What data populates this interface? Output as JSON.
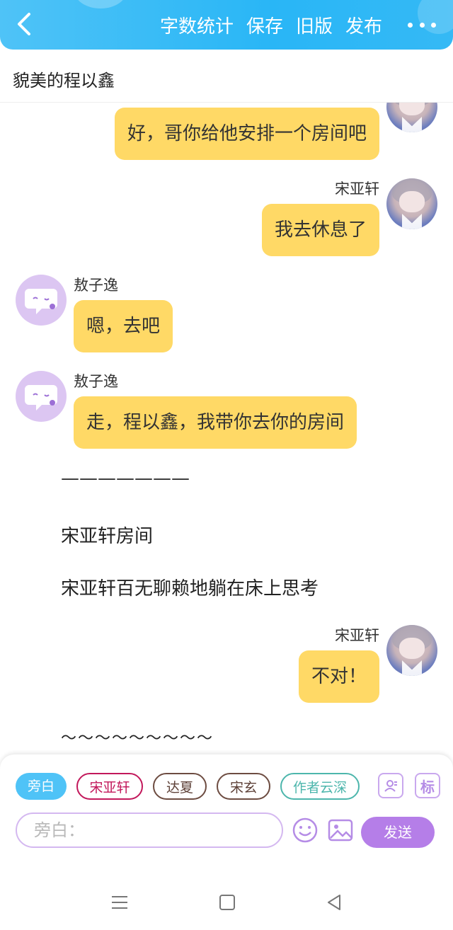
{
  "header": {
    "actions": [
      "字数统计",
      "保存",
      "旧版",
      "发布"
    ]
  },
  "title": "貌美的程以鑫",
  "messages": [
    {
      "text": "好，哥你给他安排一个房间吧"
    },
    {
      "name": "宋亚轩",
      "text": "我去休息了"
    },
    {
      "name": "敖子逸",
      "text": "嗯，去吧"
    },
    {
      "name": "敖子逸",
      "text": "走，程以鑫，我带你去你的房间"
    },
    {
      "name": "宋亚轩",
      "text": "不对！"
    }
  ],
  "narration": [
    "———————",
    "宋亚轩房间",
    "宋亚轩百无聊赖地躺在床上思考",
    "～～～～～～～～～"
  ],
  "roles": [
    "旁白",
    "宋亚轩",
    "达夏",
    "宋玄",
    "作者云深"
  ],
  "tag_label": "标",
  "input": {
    "placeholder": "旁白："
  },
  "send_label": "发送",
  "colors": {
    "header": "#29b6f6",
    "bubble": "#ffd966",
    "send": "#b57ee8",
    "narration_chip": "#4fc3f7"
  },
  "icons": [
    "back-icon",
    "more-icon",
    "role-card-icon",
    "emoji-icon",
    "image-icon",
    "menu-icon",
    "home-icon",
    "back-nav-icon"
  ]
}
